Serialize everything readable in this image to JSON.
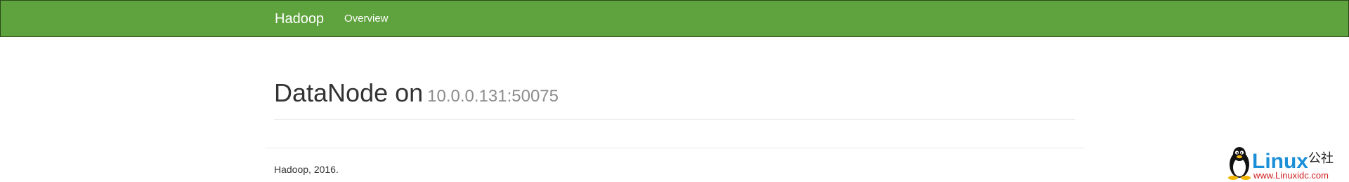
{
  "navbar": {
    "brand": "Hadoop",
    "links": [
      "Overview"
    ]
  },
  "header": {
    "title": "DataNode on",
    "host": "10.0.0.131:50075"
  },
  "footer": {
    "text": "Hadoop, 2016."
  },
  "watermark": {
    "brand": "Linux",
    "brand_cn": "公社",
    "url": "www.Linuxidc.com",
    "icon": "tux-penguin-icon"
  },
  "colors": {
    "navbar_bg": "#5fa33e",
    "navbar_border": "#2a4a1b",
    "muted_text": "#8c8c8c",
    "watermark_blue": "#1a8fd8",
    "watermark_red": "#d32020"
  }
}
